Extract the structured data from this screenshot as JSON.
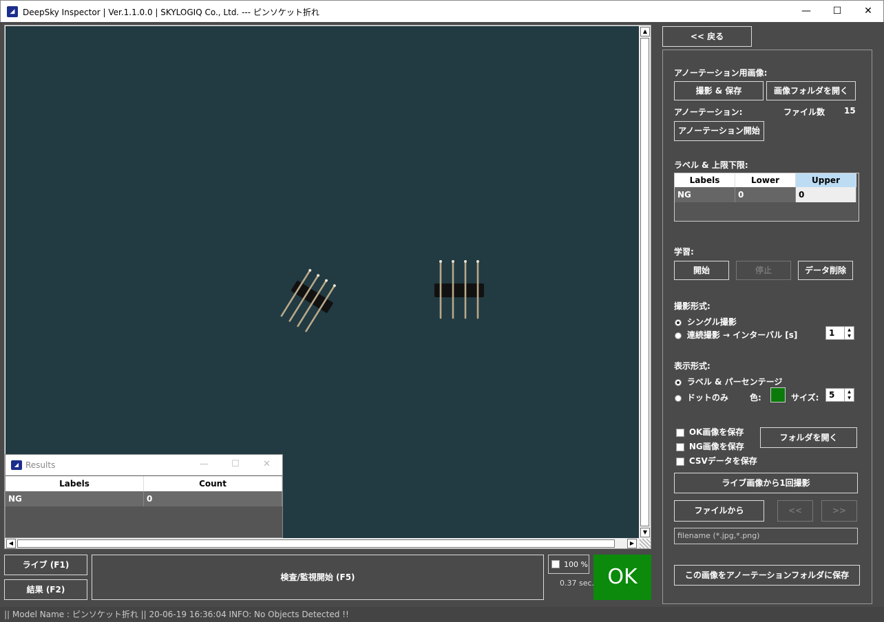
{
  "window": {
    "title": "DeepSky Inspector | Ver.1.1.0.0 | SKYLOGIQ Co., Ltd. --- ピンソケット折れ",
    "minimize": "—",
    "maximize": "☐",
    "close": "✕"
  },
  "results_window": {
    "title": "Results",
    "columns": [
      "Labels",
      "Count"
    ],
    "rows": [
      {
        "label": "NG",
        "count": "0"
      }
    ]
  },
  "bottom": {
    "live_button": "ライブ (F1)",
    "result_button": "結果 (F2)",
    "inspect_button": "検査/監視開始 (F5)",
    "zoom_percent": "100 %",
    "elapsed": "0.37 sec.",
    "verdict": "OK"
  },
  "status": {
    "text": "|| Model Name : ピンソケット折れ ||     20-06-19 16:36:04    INFO:    No Objects Detected !!"
  },
  "panel": {
    "back_button": "<< 戻る",
    "annotation_image_label": "アノーテーション用画像:",
    "capture_save_button": "撮影 & 保存",
    "open_image_folder_button": "画像フォルダを開く",
    "annotation_label": "アノーテーション:",
    "file_count_label": "ファイル数",
    "file_count": "15",
    "start_annotation_button": "アノーテーション開始",
    "label_limits_label": "ラベル & 上限下限:",
    "label_table": {
      "columns": [
        "Labels",
        "Lower",
        "Upper"
      ],
      "rows": [
        {
          "label": "NG",
          "lower": "0",
          "upper": "0"
        }
      ]
    },
    "training_label": "学習:",
    "start_button": "開始",
    "stop_button": "停止",
    "delete_data_button": "データ削除",
    "capture_mode_label": "撮影形式:",
    "single_capture": "シングル撮影",
    "continuous_capture": "連続撮影 → インターバル [s]",
    "interval_value": "1",
    "display_mode_label": "表示形式:",
    "label_percentage": "ラベル & パーセンテージ",
    "dots_only": "ドットのみ",
    "color_label": "色:",
    "size_label": "サイズ:",
    "size_value": "5",
    "save_ok": "OK画像を保存",
    "save_ng": "NG画像を保存",
    "save_csv": "CSVデータを保存",
    "open_folder_button": "フォルダを開く",
    "capture_once_button": "ライブ画像から1回撮影",
    "from_file_button": "ファイルから",
    "prev_button": "<<",
    "next_button": ">>",
    "filename_placeholder": "filename (*.jpg,*.png)",
    "save_to_annotation_button": "この画像をアノーテーションフォルダに保存"
  }
}
